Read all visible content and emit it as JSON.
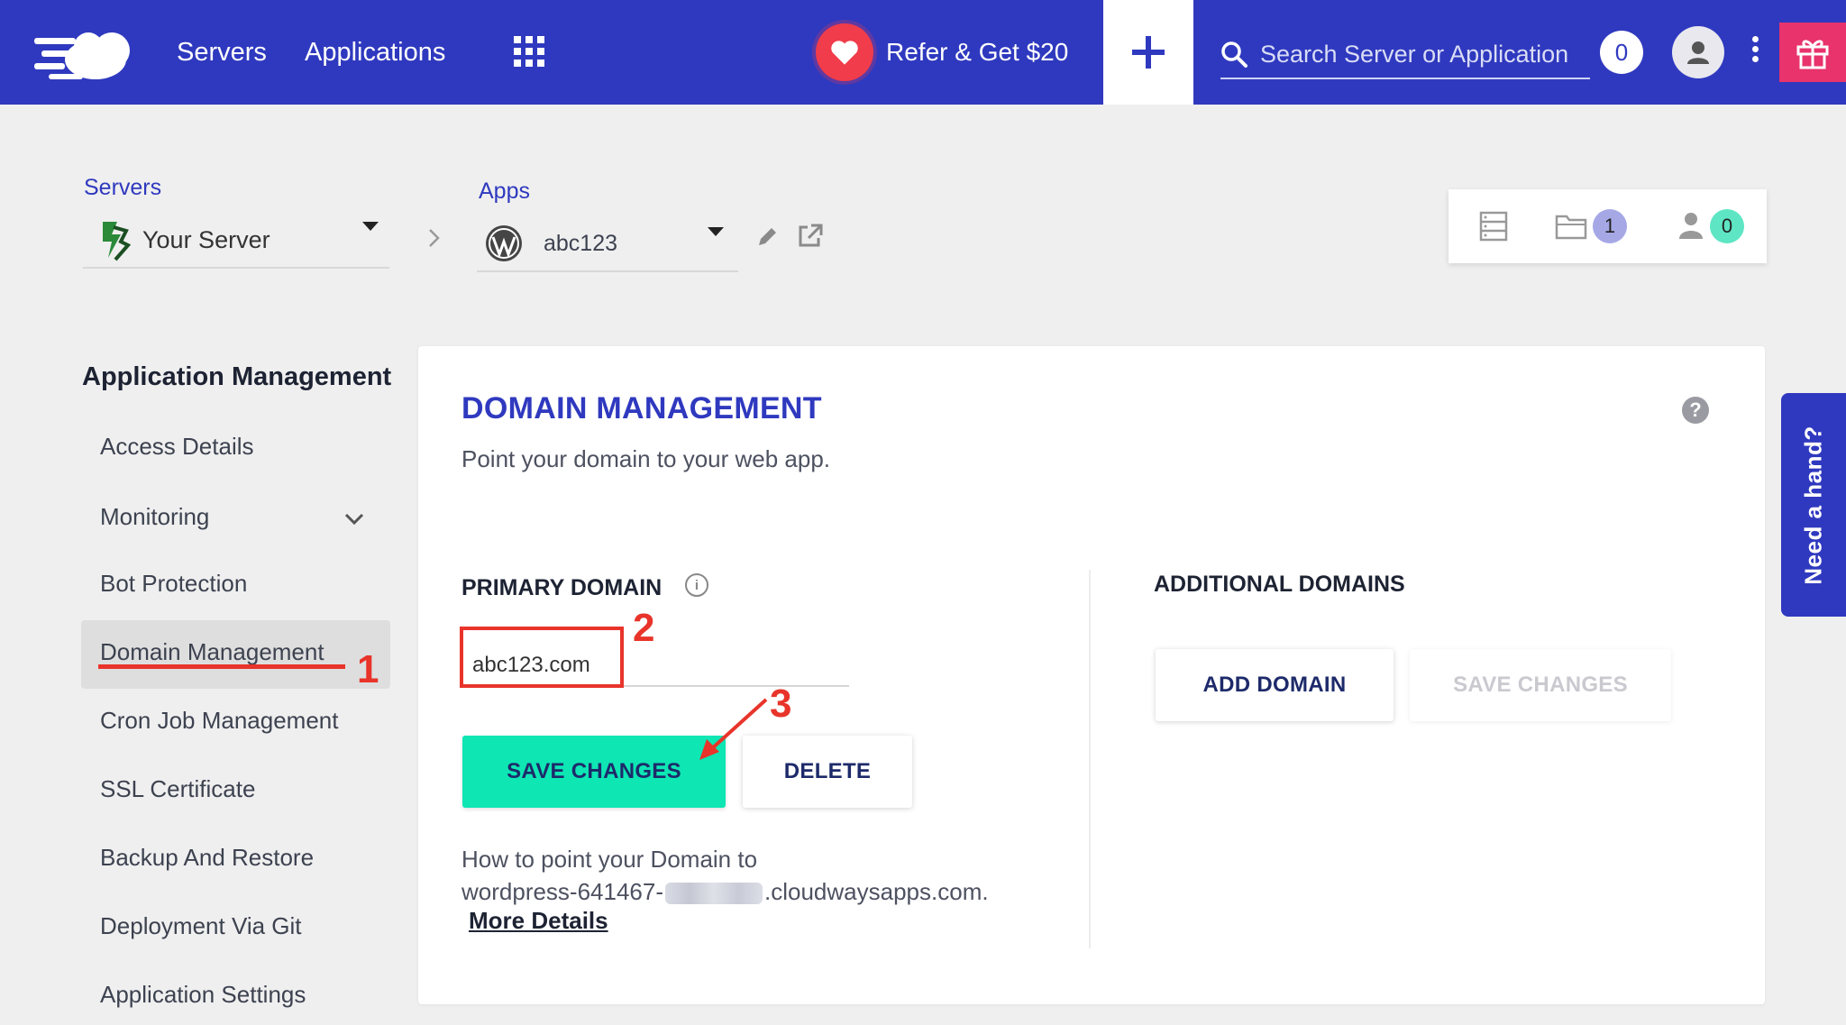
{
  "topbar": {
    "nav": [
      "Servers",
      "Applications"
    ],
    "refer_label": "Refer & Get $20",
    "search_placeholder": "Search Server or Application",
    "notification_count": "0",
    "colors": {
      "bar": "#2f39bf",
      "refer": "#f03c4b",
      "gift": "#e8336d"
    }
  },
  "breadcrumb": {
    "servers_label": "Servers",
    "server_name": "Your Server",
    "apps_label": "Apps",
    "app_name": "abc123"
  },
  "stats": {
    "apps_count": "1",
    "members_count": "0"
  },
  "sidebar": {
    "title": "Application Management",
    "items": [
      "Access Details",
      "Monitoring",
      "Bot Protection",
      "Domain Management",
      "Cron Job Management",
      "SSL Certificate",
      "Backup And Restore",
      "Deployment Via Git",
      "Application Settings"
    ],
    "active_item": "Domain Management"
  },
  "main": {
    "title": "DOMAIN MANAGEMENT",
    "subtitle": "Point your domain to your web app.",
    "help_icon": "?",
    "primary": {
      "title": "PRIMARY DOMAIN",
      "info_icon": "i",
      "value": "abc123.com",
      "save_label": "SAVE CHANGES",
      "delete_label": "DELETE",
      "how_line1": "How to point your Domain to",
      "how_prefix": "wordpress-641467-",
      "how_suffix": ".cloudwaysapps.com.",
      "more_details": "More Details"
    },
    "additional": {
      "title": "ADDITIONAL DOMAINS",
      "add_label": "ADD DOMAIN",
      "save_label": "SAVE CHANGES"
    }
  },
  "need_hand": "Need a hand?",
  "annotations": [
    "1",
    "2",
    "3"
  ]
}
